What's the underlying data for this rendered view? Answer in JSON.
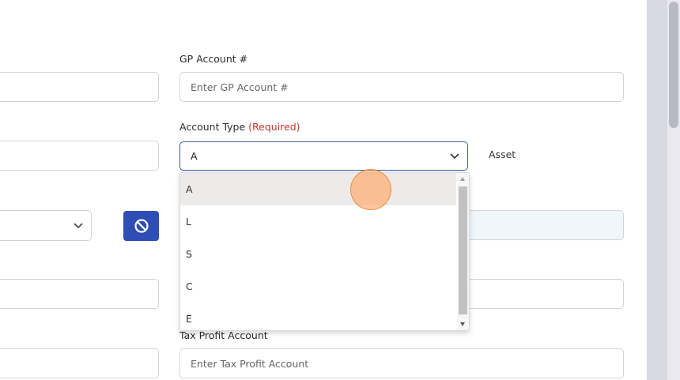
{
  "form": {
    "gp_account_label": "GP Account #",
    "gp_account_placeholder": "Enter GP Account #",
    "account_type_label": "Account Type",
    "required_tag": "(Required)",
    "account_type_value": "A",
    "account_type_description": "Asset",
    "tax_profit_label": "Tax Profit Account",
    "tax_profit_placeholder": "Enter Tax Profit Account"
  },
  "dropdown": {
    "options": [
      "A",
      "L",
      "S",
      "C",
      "E"
    ],
    "highlighted": "A"
  },
  "colors": {
    "required": "#c0392b",
    "primary_button": "#2e4db5",
    "focus_border": "#3a5aa8",
    "option_highlight": "#edebe9",
    "click_indicator": "#f9a25f"
  },
  "icons": {
    "block_button": "block-icon",
    "select_arrow": "chevron-down-icon"
  }
}
